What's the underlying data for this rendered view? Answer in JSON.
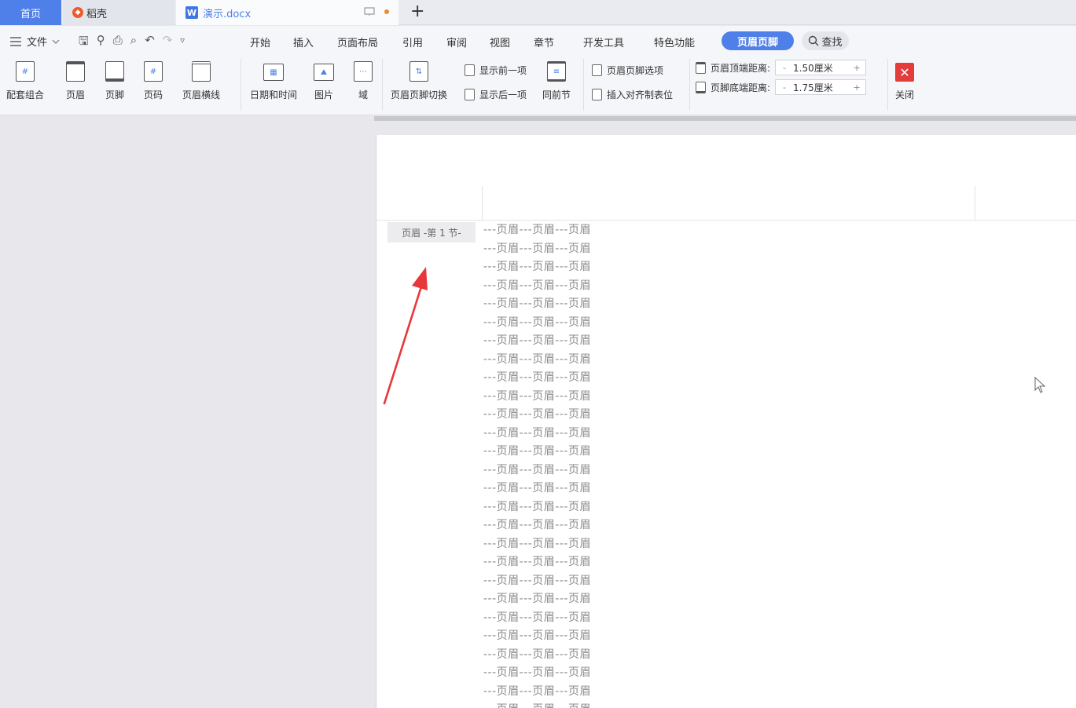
{
  "tabs": {
    "home": "首页",
    "daoke": "稻壳",
    "doc": "演示.docx"
  },
  "menu": {
    "file": "文件",
    "items": [
      "开始",
      "插入",
      "页面布局",
      "引用",
      "审阅",
      "视图",
      "章节",
      "开发工具",
      "特色功能"
    ],
    "active": "页眉页脚",
    "search": "查找"
  },
  "ribbon": {
    "combo": "配套组合",
    "header": "页眉",
    "footer": "页脚",
    "pagenum": "页码",
    "header_line": "页眉横线",
    "datetime": "日期和时间",
    "picture": "图片",
    "field": "域",
    "switch": "页眉页脚切换",
    "show_prev": "显示前一项",
    "show_next": "显示后一项",
    "same_section": "同前节",
    "options": "页眉页脚选项",
    "insert_tab": "插入对齐制表位",
    "top_dist_label": "页眉顶端距离:",
    "top_dist_value": "1.50厘米",
    "bottom_dist_label": "页脚底端距离:",
    "bottom_dist_value": "1.75厘米",
    "close": "关闭"
  },
  "document": {
    "header_tag": "页眉 -第 1 节-",
    "header_line_text": "---页眉---页眉---页眉",
    "header_line_count": 27
  },
  "colors": {
    "accent": "#4f7fe8",
    "close": "#e23c3c",
    "arrow": "#e8373a"
  }
}
